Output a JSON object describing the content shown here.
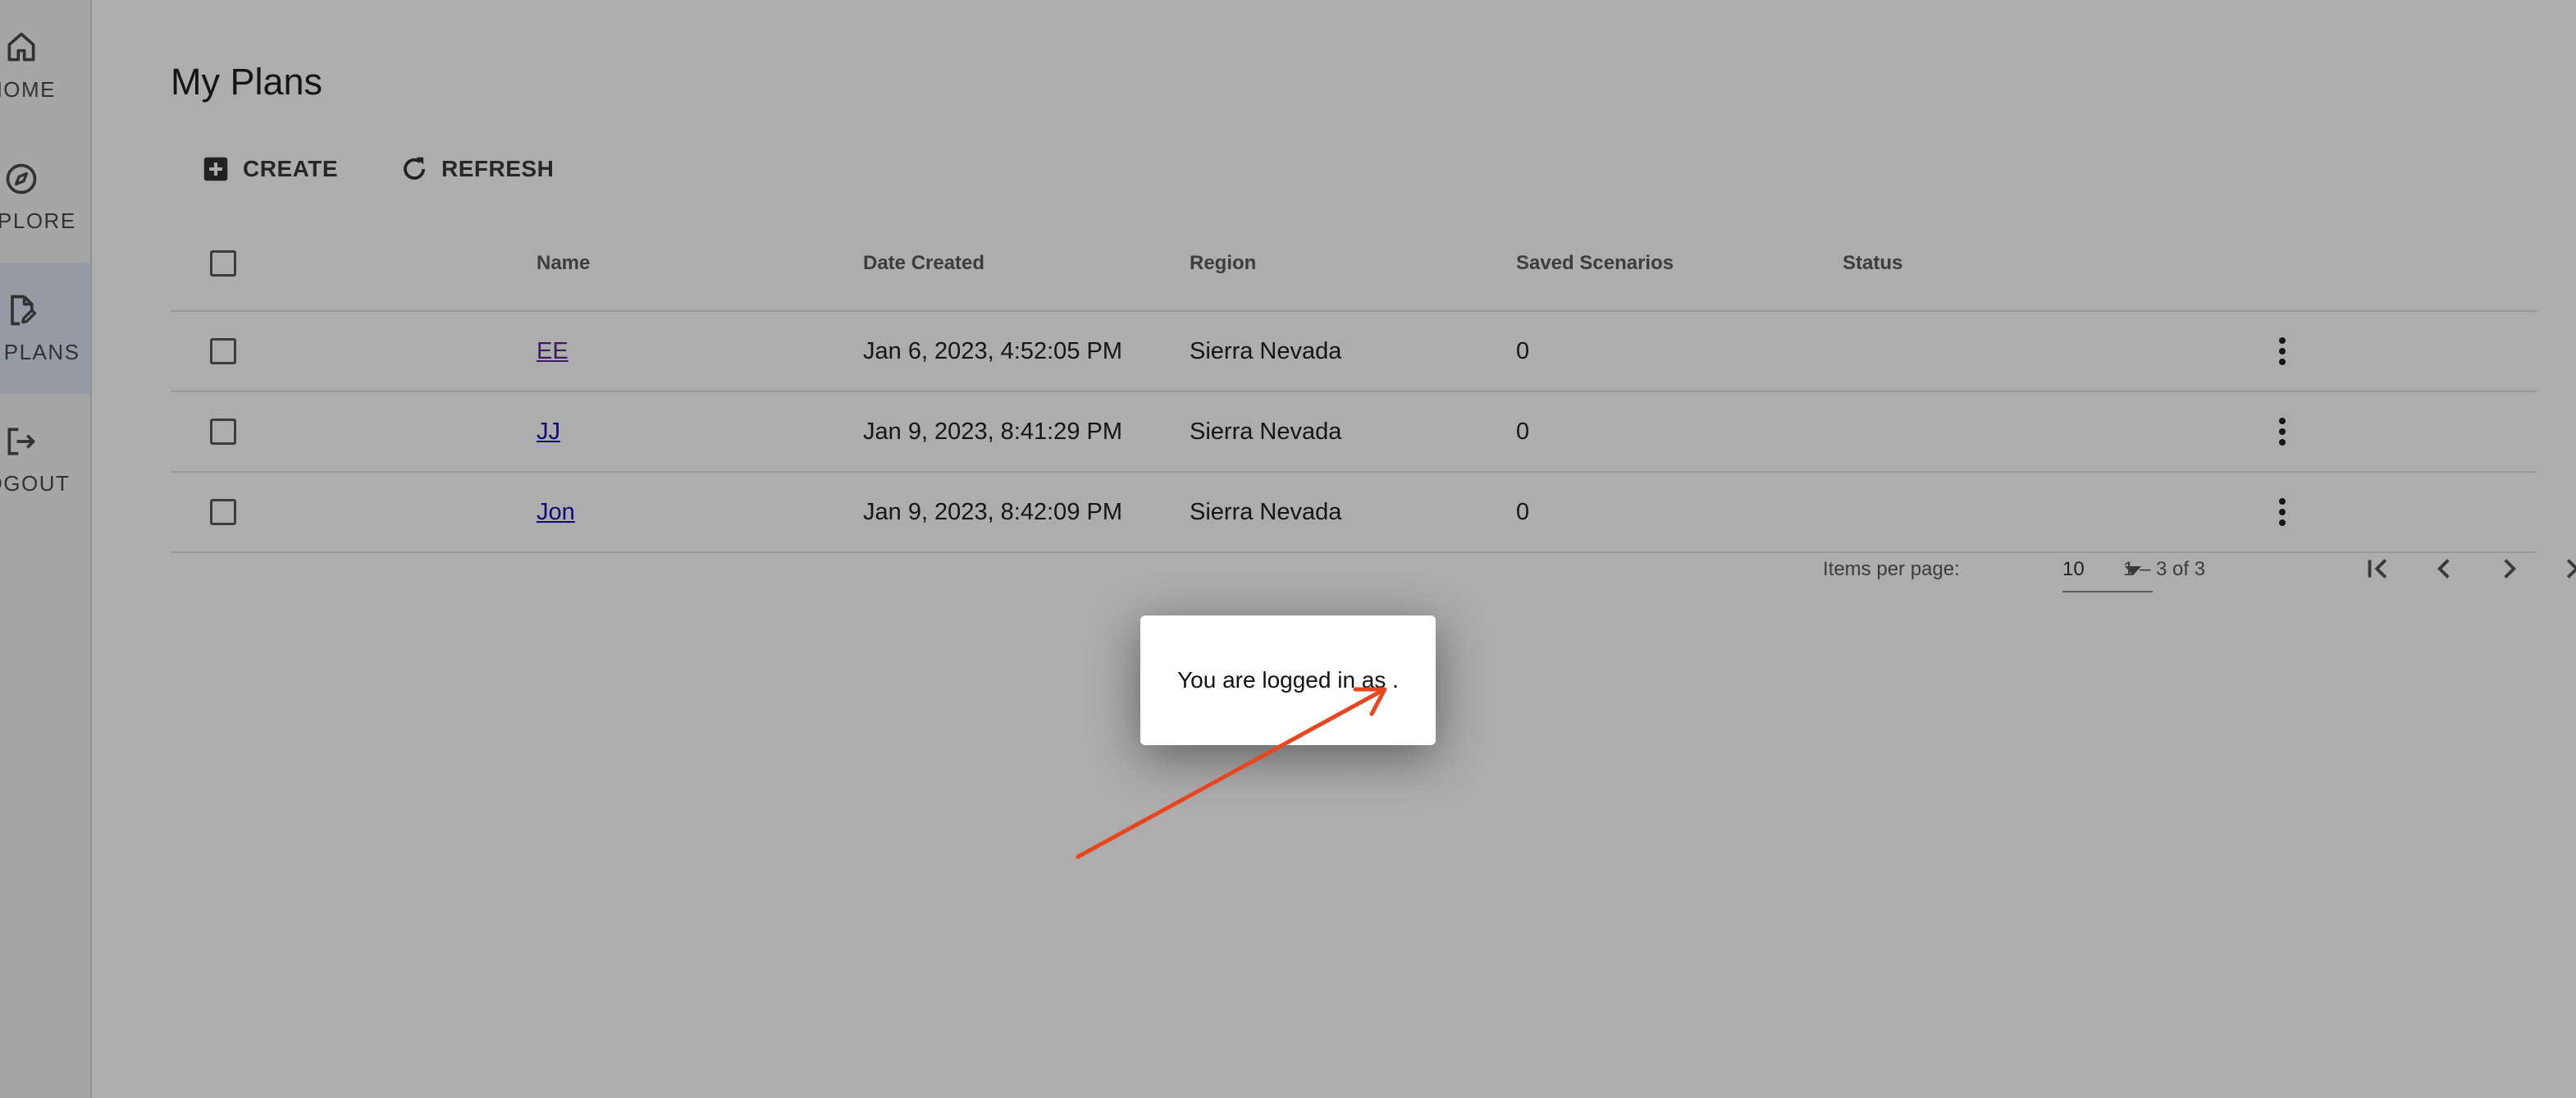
{
  "sidebar": {
    "items": [
      {
        "label": "HOME",
        "icon": "home-icon",
        "active": false
      },
      {
        "label": "EXPLORE",
        "icon": "compass-icon",
        "active": false
      },
      {
        "label": "MY PLANS",
        "icon": "document-edit-icon",
        "active": true
      },
      {
        "label": "LOGOUT",
        "icon": "logout-icon",
        "active": false
      }
    ]
  },
  "page": {
    "title": "My Plans"
  },
  "toolbar": {
    "create_label": "CREATE",
    "refresh_label": "REFRESH"
  },
  "table": {
    "headers": {
      "name": "Name",
      "date_created": "Date Created",
      "region": "Region",
      "saved_scenarios": "Saved Scenarios",
      "status": "Status"
    },
    "rows": [
      {
        "name": "EE",
        "date_created": "Jan 6, 2023, 4:52:05 PM",
        "region": "Sierra Nevada",
        "saved_scenarios": "0",
        "status": ""
      },
      {
        "name": "JJ",
        "date_created": "Jan 9, 2023, 8:41:29 PM",
        "region": "Sierra Nevada",
        "saved_scenarios": "0",
        "status": ""
      },
      {
        "name": "Jon",
        "date_created": "Jan 9, 2023, 8:42:09 PM",
        "region": "Sierra Nevada",
        "saved_scenarios": "0",
        "status": ""
      }
    ]
  },
  "paginator": {
    "items_per_page_label": "Items per page:",
    "page_size": "10",
    "range_label": "1 – 3 of 3"
  },
  "dialog": {
    "message": "You are logged in as ."
  },
  "colors": {
    "overlay": "#000000",
    "annotation_arrow": "#e8461e",
    "active_nav": "#dde3f2",
    "link": "#1a0dab"
  }
}
